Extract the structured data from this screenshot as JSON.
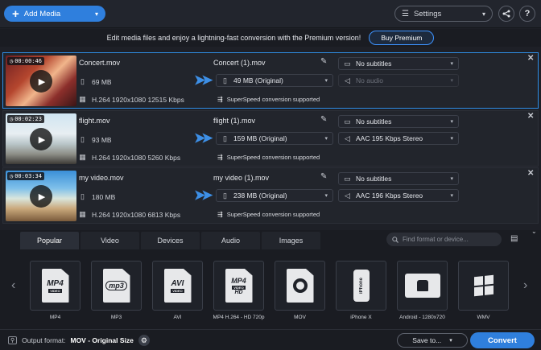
{
  "toolbar": {
    "add_media": "Add Media",
    "settings": "Settings",
    "share_icon": "share-icon",
    "help": "?"
  },
  "promo": {
    "text": "Edit media files and enjoy a lightning-fast conversion with the Premium version!",
    "buy": "Buy Premium"
  },
  "files": [
    {
      "duration": "00:00:46",
      "name": "Concert.mov",
      "size": "69 MB",
      "codec": "H.264 1920x1080 12515 Kbps",
      "out_name": "Concert (1).mov",
      "out_size": "49 MB (Original)",
      "superspeed": "SuperSpeed conversion supported",
      "subtitles": "No subtitles",
      "audio": "No audio",
      "selected": true
    },
    {
      "duration": "00:02:23",
      "name": "flight.mov",
      "size": "93 MB",
      "codec": "H.264 1920x1080 5260 Kbps",
      "out_name": "flight (1).mov",
      "out_size": "159 MB (Original)",
      "superspeed": "SuperSpeed conversion supported",
      "subtitles": "No subtitles",
      "audio": "AAC 195 Kbps Stereo",
      "selected": false
    },
    {
      "duration": "00:03:34",
      "name": "my video.mov",
      "size": "180 MB",
      "codec": "H.264 1920x1080 6813 Kbps",
      "out_name": "my video (1).mov",
      "out_size": "238 MB (Original)",
      "superspeed": "SuperSpeed conversion supported",
      "subtitles": "No subtitles",
      "audio": "AAC 196 Kbps Stereo",
      "selected": false
    }
  ],
  "format_tabs": [
    "Popular",
    "Video",
    "Devices",
    "Audio",
    "Images"
  ],
  "active_tab": "Popular",
  "search": {
    "placeholder": "Find format or device..."
  },
  "formats": [
    {
      "label": "MP4",
      "icon": "mp4-icon"
    },
    {
      "label": "MP3",
      "icon": "mp3-icon"
    },
    {
      "label": "AVI",
      "icon": "avi-icon"
    },
    {
      "label": "MP4 H.264 - HD 720p",
      "icon": "mp4-hd-icon"
    },
    {
      "label": "MOV",
      "icon": "quicktime-icon"
    },
    {
      "label": "iPhone X",
      "icon": "iphone-icon"
    },
    {
      "label": "Android - 1280x720",
      "icon": "android-icon"
    },
    {
      "label": "WMV",
      "icon": "windows-icon"
    }
  ],
  "icon_text": {
    "mp4": "MP4",
    "mp3": "mp3",
    "avi": "AVI",
    "hd": "HD",
    "video_tag": "VIDEO",
    "iphone": "iPhone"
  },
  "bottom": {
    "output_label": "Output format:",
    "output_value": "MOV - Original Size",
    "save_to": "Save to...",
    "convert": "Convert"
  },
  "colors": {
    "accent": "#2f7fdd",
    "background": "#1e2027",
    "selected_border": "#2f8ee6"
  }
}
